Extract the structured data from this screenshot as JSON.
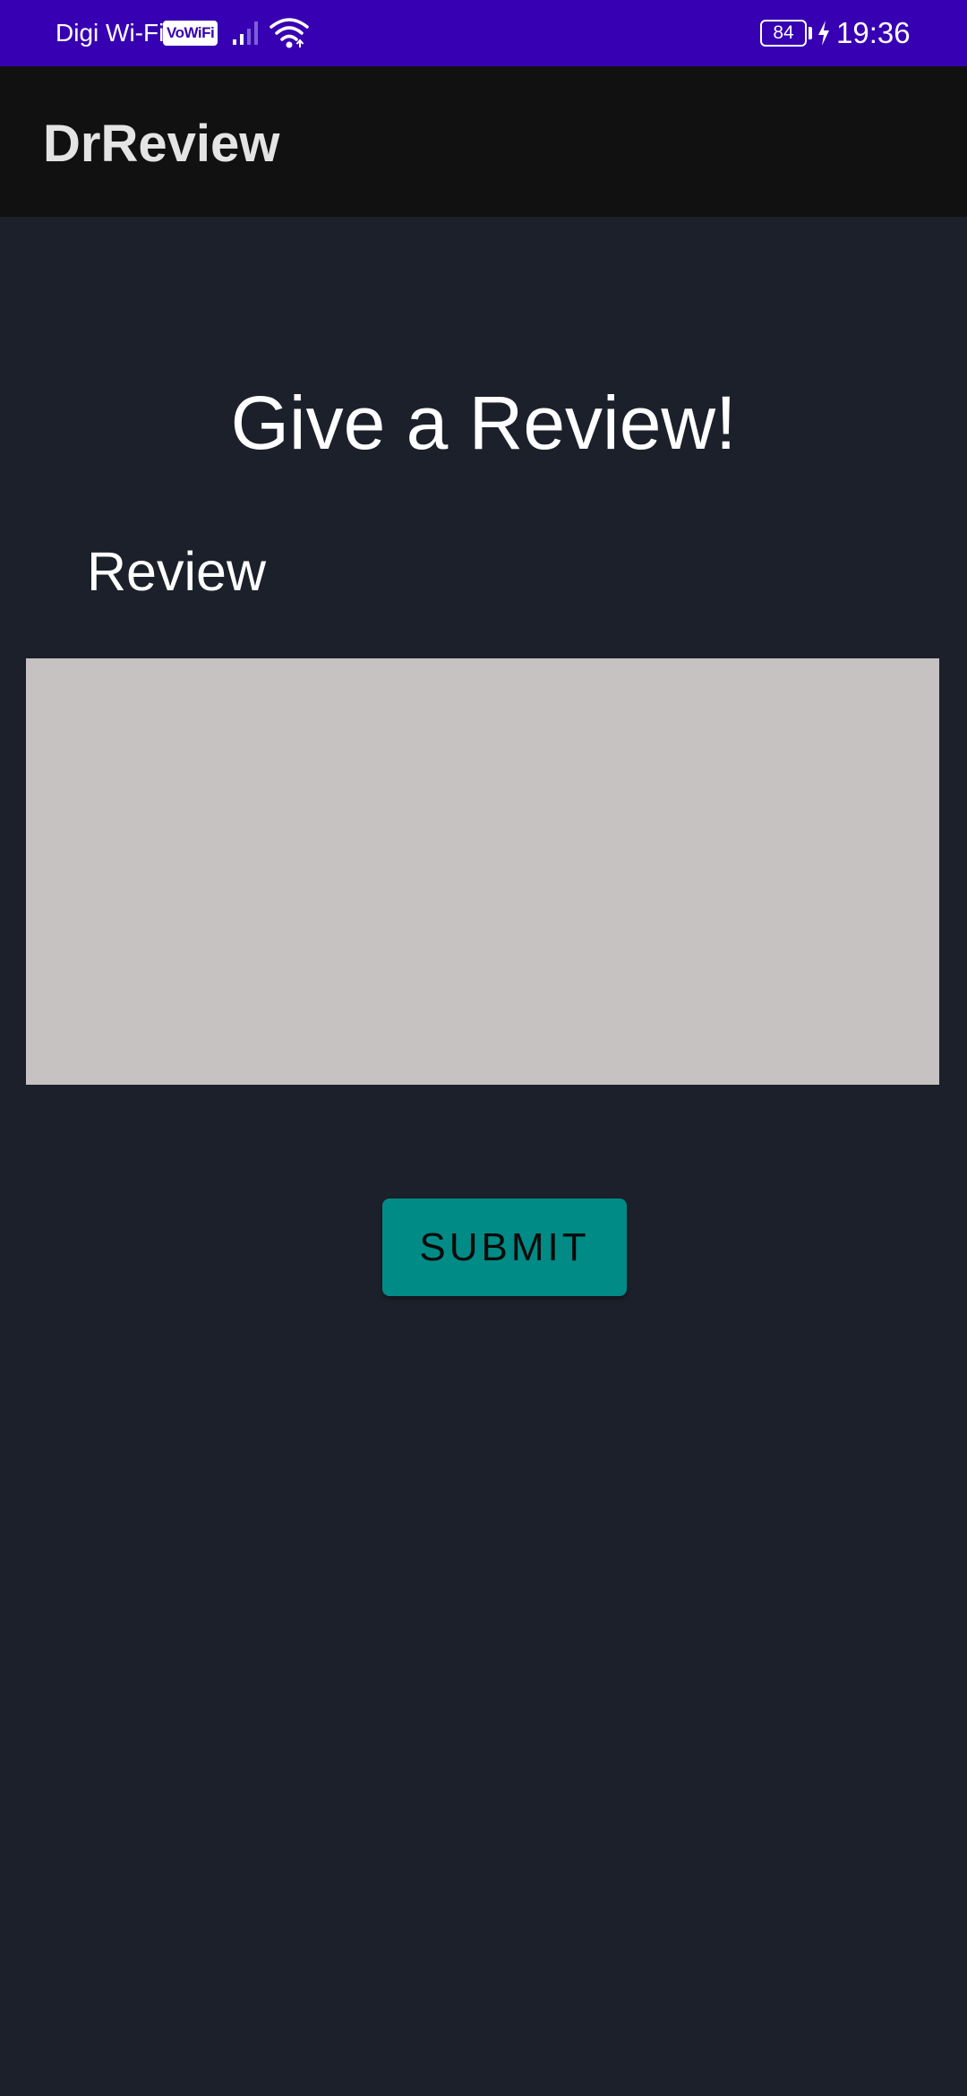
{
  "status_bar": {
    "carrier": "Digi Wi-Fi",
    "vowifi_badge": "VoWiFi",
    "battery_level": "84",
    "time": "19:36",
    "icons": [
      "signal-icon",
      "wifi-icon",
      "battery-icon",
      "charging-icon"
    ],
    "background_color": "#3700b3"
  },
  "app_bar": {
    "title": "DrReview",
    "background_color": "#111111"
  },
  "main": {
    "heading": "Give a Review!",
    "review_label": "Review",
    "review_input": {
      "value": "",
      "placeholder": "",
      "background_color": "#c5c2c1"
    },
    "submit_label": "SUBMIT",
    "submit_color": "#008b86",
    "background_color": "#1b202a"
  }
}
